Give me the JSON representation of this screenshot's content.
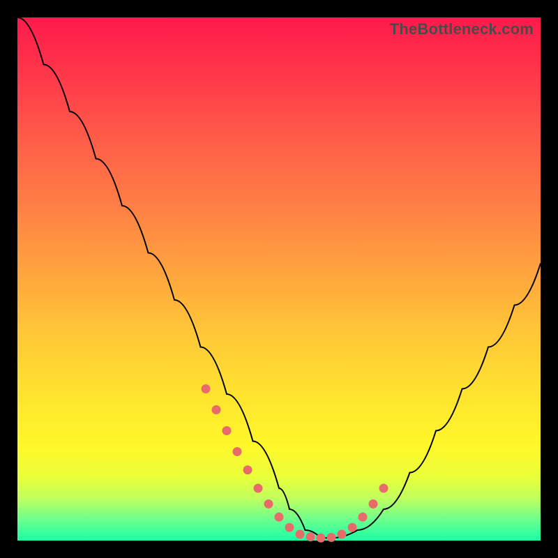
{
  "watermark": "TheBottleneck.com",
  "colors": {
    "page_bg": "#000000",
    "curve_stroke": "#000000",
    "dot_fill": "#e96a6a"
  },
  "chart_data": {
    "type": "line",
    "title": "",
    "xlabel": "",
    "ylabel": "",
    "xlim": [
      0,
      100
    ],
    "ylim": [
      0,
      100
    ],
    "series": [
      {
        "name": "bottleneck-curve",
        "x": [
          0,
          5,
          10,
          15,
          20,
          25,
          30,
          35,
          40,
          45,
          50,
          52,
          55,
          58,
          60,
          65,
          70,
          75,
          80,
          85,
          90,
          95,
          100
        ],
        "y": [
          100,
          91,
          82,
          73,
          64,
          55,
          46,
          37,
          28,
          19,
          10,
          6,
          2,
          0.5,
          0.5,
          2,
          6,
          13,
          21,
          29,
          37,
          45,
          53
        ]
      }
    ],
    "markers": {
      "name": "highlight-dots",
      "x": [
        36,
        38,
        40,
        42,
        44,
        46,
        48,
        50,
        52,
        54,
        56,
        58,
        60,
        62,
        64,
        66,
        68,
        70
      ],
      "y": [
        29,
        25,
        21,
        17,
        13.5,
        10,
        7,
        4.5,
        2.5,
        1.2,
        0.7,
        0.5,
        0.6,
        1.2,
        2.5,
        4.5,
        7,
        10
      ]
    }
  }
}
